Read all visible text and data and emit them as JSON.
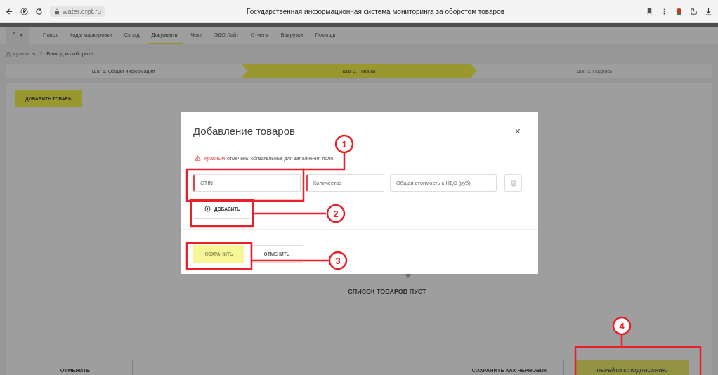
{
  "browser": {
    "url": "water.crpt.ru",
    "title": "Государственная информационная система мониторинга за оборотом товаров"
  },
  "nav": {
    "items": [
      {
        "label": "Поиск",
        "selected": false
      },
      {
        "label": "Коды маркировки",
        "selected": false
      },
      {
        "label": "Склад",
        "selected": false
      },
      {
        "label": "Документы",
        "selected": true
      },
      {
        "label": "Чеки",
        "selected": false
      },
      {
        "label": "ЭДО Лайт",
        "selected": false
      },
      {
        "label": "Отчеты",
        "selected": false
      },
      {
        "label": "Выгрузки",
        "selected": false
      },
      {
        "label": "Помощь",
        "selected": false
      }
    ]
  },
  "breadcrumbs": [
    "Документы",
    "Вывод из оборота"
  ],
  "steps": [
    {
      "label": "Шаг 1. Общая информация",
      "selected": false,
      "disabled": false
    },
    {
      "label": "Шаг 2. Товары",
      "selected": true,
      "disabled": false
    },
    {
      "label": "Шаг 3. Подпись",
      "selected": false,
      "disabled": true
    }
  ],
  "add_products_button": "ДОБАВИТЬ ТОВАРЫ",
  "empty_message": "СПИСОК ТОВАРОВ ПУСТ",
  "footer_buttons": [
    {
      "label": "ОТМЕНИТЬ",
      "kind": "outline"
    },
    {
      "label": "СОХРАНИТЬ КАК ЧЕРНОВИК",
      "kind": "outline"
    },
    {
      "label": "ПЕРЕЙТИ К ПОДПИСАНИЮ",
      "kind": "primary"
    }
  ],
  "modal": {
    "title": "Добавление товаров",
    "close": "×",
    "warning_highlight": "Красным",
    "warning_text": "отмечены обязательные для заполнения поля",
    "fields": [
      {
        "placeholder": "GTIN",
        "required": true
      },
      {
        "placeholder": "Количество",
        "required": true
      },
      {
        "placeholder": "Общая стоимость с НДС (руб)",
        "required": false
      }
    ],
    "add_button": "ДОБАВИТЬ",
    "save_button": {
      "label": "СОХРАНИТЬ",
      "disabled": true
    },
    "cancel_button": "ОТМЕНИТЬ"
  },
  "annotations": [
    {
      "number": "1"
    },
    {
      "number": "2"
    },
    {
      "number": "3"
    },
    {
      "number": "4"
    }
  ]
}
